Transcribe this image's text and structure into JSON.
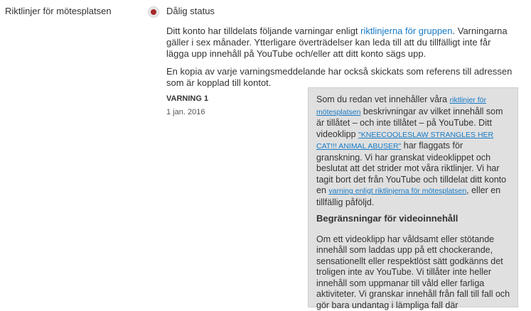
{
  "section": {
    "label": "Riktlinjer för mötesplatsen",
    "status": "Dålig status"
  },
  "intro": {
    "p1_before": "Ditt konto har tilldelats följande varningar enligt ",
    "p1_link": "riktlinjerna för gruppen",
    "p1_after": ". Varningarna gäller i sex månader. Ytterligare överträdelser kan leda till att du tillfälligt inte får lägga upp innehåll på YouTube och/eller att ditt konto sägs upp.",
    "p2": "En kopia av varje varningsmeddelande har också skickats som referens till adressen som är kopplad till kontot."
  },
  "warning": {
    "title": "VARNING 1",
    "date": "1 jan. 2016"
  },
  "tooltip": {
    "t1": "Som du redan vet innehåller våra ",
    "link1": "riktlinjer för mötesplatsen",
    "t2": " beskrivningar av vilket innehåll som är tillåtet – och inte tillåtet – på YouTube. Ditt videoklipp ",
    "video_link": "\"KNEECOOLESLAW STRANGLES HER CAT!!! ANIMAL ABUSER\"",
    "t3": " har flaggats för granskning. Vi har granskat videoklippet och beslutat att det strider mot våra riktlinjer. Vi har tagit bort det från YouTube och tilldelat ditt konto en ",
    "link2": "varning enligt riktlinjerna för mötesplatsen",
    "t4": ", eller en tillfällig påföljd.",
    "heading": "Begränsningar för videoinnehåll",
    "body": "Om ett videoklipp har våldsamt eller stötande innehåll som laddas upp på ett chockerande, sensationellt eller respektlöst sätt godkänns det troligen inte av YouTube. Vi tillåter inte heller innehåll som uppmanar till våld eller farliga aktiviteter. Vi granskar innehåll från fall till fall och gör bara undantag i lämpliga fall där"
  }
}
